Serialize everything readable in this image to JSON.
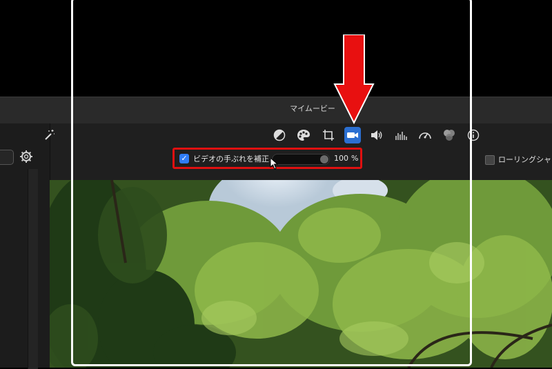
{
  "window": {
    "title": "マイムービー"
  },
  "toolbar": {
    "icons": [
      "magic-wand-icon",
      "color-balance-icon",
      "color-palette-icon",
      "crop-icon",
      "stabilization-camera-icon",
      "volume-icon",
      "equalizer-icon",
      "speed-gauge-icon",
      "filter-circles-icon",
      "info-icon"
    ],
    "active": "stabilization-camera-icon"
  },
  "stabilization": {
    "checked": true,
    "label": "ビデオの手ぶれを補正:",
    "value": "100",
    "unit": "%",
    "level": 1.0
  },
  "rolling_shutter": {
    "label": "ローリングシャッ",
    "checked": false
  },
  "colors": {
    "accent": "#2b6fd1",
    "highlight": "#e01010"
  }
}
